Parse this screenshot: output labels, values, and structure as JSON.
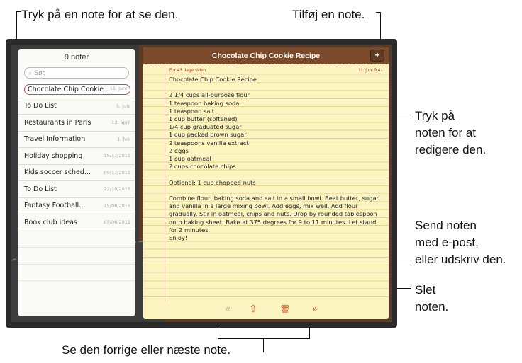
{
  "callouts": {
    "tap_note": "Tryk på en note for at se den.",
    "add_note": "Tilføj en note.",
    "edit_line1": "Tryk på",
    "edit_line2": "noten for at",
    "edit_line3": "redigere den.",
    "send_line1": "Send noten",
    "send_line2": "med e-post,",
    "send_line3": "eller udskriv den.",
    "delete_line1": "Slet",
    "delete_line2": "noten.",
    "prev_next": "Se den forrige eller næste note."
  },
  "list": {
    "count": "9 noter",
    "search_placeholder": "Søg",
    "notes": [
      {
        "title": "Chocolate Chip Cookie...",
        "date": "11. juni"
      },
      {
        "title": "To Do List",
        "date": "5. juni"
      },
      {
        "title": "Restaurants in Paris",
        "date": "13. april"
      },
      {
        "title": "Travel Information",
        "date": "1. feb"
      },
      {
        "title": "Holiday shopping",
        "date": "15/12/2011"
      },
      {
        "title": "Kids soccer sched...",
        "date": "09/12/2011"
      },
      {
        "title": "To Do List",
        "date": "22/10/2011"
      },
      {
        "title": "Fantasy Football...",
        "date": "15/08/2011"
      },
      {
        "title": "Book club ideas",
        "date": "05/06/2011"
      }
    ]
  },
  "note": {
    "header_title": "Chocolate Chip Cookie Recipe",
    "add_label": "+",
    "meta_left": "For 43 dage siden",
    "meta_right": "11. juni  9.41",
    "body": "Chocolate Chip Cookie Recipe\n\n2 1/4 cups all-purpose flour\n1 teaspoon baking soda\n1 teaspoon salt\n1 cup butter (softened)\n1/4 cup graduated sugar\n1 cup packed brown sugar\n2 teaspoons vanilla extract\n2 eggs\n1 cup oatmeal\n2 cups chocolate chips\n\nOptional: 1 cup chopped nuts\n\nCombine flour, baking soda and salt in a small bowl. Beat butter, sugar and vanilla in a large mixing bowl. Add eggs, mix well. Add flour gradually. Stir in oatmeal, chips and nuts. Drop by rounded tablespoon onto baking sheet. Bake at 375 degrees for 9 to 11 minutes. Let stand for 2 minutes.\nEnjoy!"
  },
  "toolbar": {
    "prev_icon": "«",
    "share_icon": "⇪",
    "trash_icon": "🗑",
    "next_icon": "»"
  },
  "colors": {
    "accent": "#c45b2a",
    "header_brown": "#7a4a2a",
    "paper": "#fbf4c0",
    "selection": "#d2493a"
  }
}
